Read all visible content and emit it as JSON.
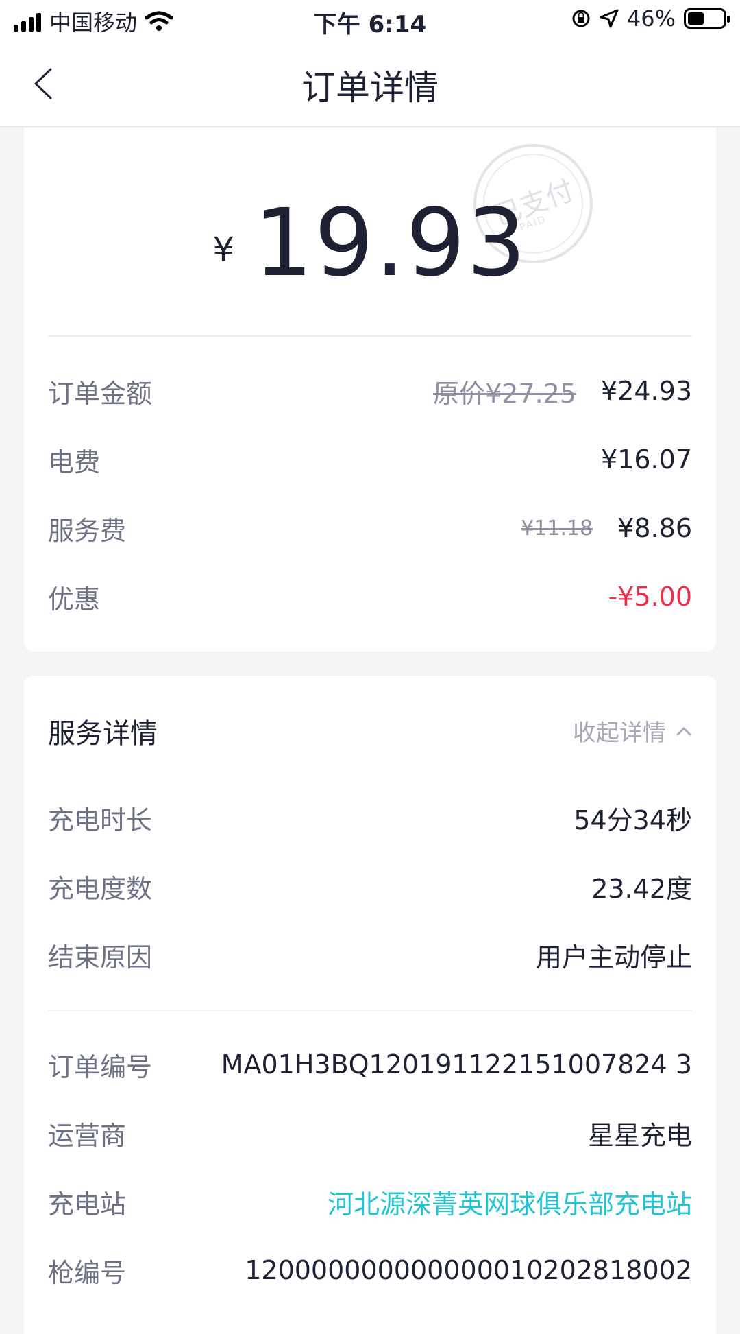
{
  "status_bar": {
    "carrier": "中国移动",
    "time": "下午 6:14",
    "battery_text": "46%",
    "battery_level": 0.46
  },
  "nav": {
    "title": "订单详情"
  },
  "summary": {
    "currency": "¥",
    "total": "19.93",
    "stamp_text": "已支付",
    "stamp_sub": "PAID",
    "rows": [
      {
        "label": "订单金额",
        "original": "原价¥27.25",
        "value": "¥24.93"
      },
      {
        "label": "电费",
        "value": "¥16.07"
      },
      {
        "label": "服务费",
        "original": "¥11.18",
        "value": "¥8.86"
      },
      {
        "label": "优惠",
        "value": "-¥5.00"
      }
    ]
  },
  "service": {
    "title": "服务详情",
    "toggle_label": "收起详情",
    "rows": [
      {
        "label": "充电时长",
        "value": "54分34秒"
      },
      {
        "label": "充电度数",
        "value": "23.42度"
      },
      {
        "label": "结束原因",
        "value": "用户主动停止"
      }
    ],
    "info_rows": [
      {
        "label": "订单编号",
        "value": "MA01H3BQ120191122151007824 3"
      },
      {
        "label": "运营商",
        "value": "星星充电"
      },
      {
        "label": "充电站",
        "value": "河北源深菁英网球俱乐部充电站"
      },
      {
        "label": "枪编号",
        "value": "120000000000000010202818002"
      }
    ]
  },
  "colors": {
    "accent_link": "#20c4d2",
    "discount": "#ef2d4b",
    "text_primary": "#1e2033",
    "text_label": "#6e7086"
  }
}
